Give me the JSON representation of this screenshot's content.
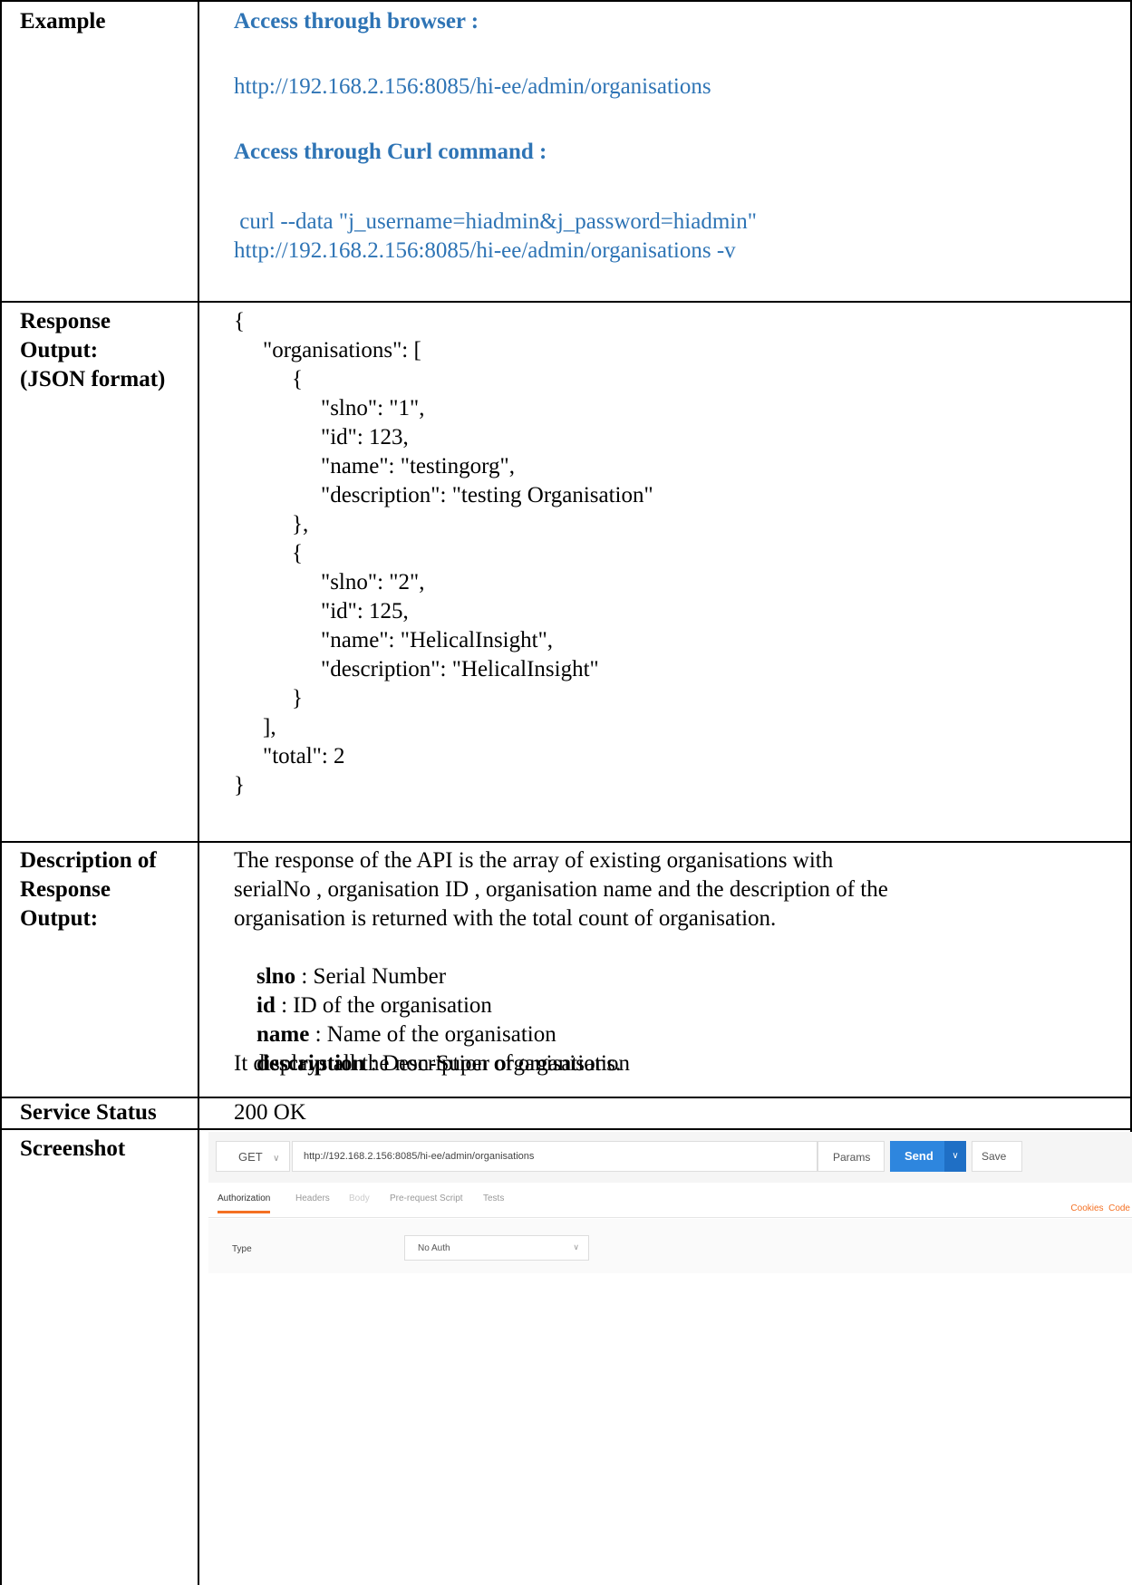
{
  "rows": {
    "example": {
      "label": "Example",
      "browser_heading": "Access through browser :",
      "browser_url": "http://192.168.2.156:8085/hi-ee/admin/organisations",
      "curl_heading": "Access through Curl command :",
      "curl_line1": " curl --data \"j_username=hiadmin&j_password=hiadmin\"",
      "curl_line2": "http://192.168.2.156:8085/hi-ee/admin/organisations -v"
    },
    "response": {
      "label_line1": "Response",
      "label_line2": "Output:",
      "label_line3": "(JSON format)",
      "json_lines": [
        "{",
        "\"organisations\": [",
        "{",
        "\"slno\": \"1\",",
        "\"id\": 123,",
        "\"name\": \"testingorg\",",
        "\"description\": \"testing Organisation\"",
        "},",
        "{",
        "\"slno\": \"2\",",
        "\"id\": 125,",
        "\"name\": \"HelicalInsight\",",
        "\"description\": \"HelicalInsight\"",
        "}",
        "],",
        "\"total\": 2",
        "}"
      ]
    },
    "description": {
      "label_line1": "Description of",
      "label_line2": "Response",
      "label_line3": "Output:",
      "para_line1": "The response of the API is the array of existing organisations with",
      "para_line2": "serialNo , organisation ID , organisation name and the description of the",
      "para_line3": "organisation is returned with the total count of organisation.",
      "fields": [
        {
          "key": "slno",
          "text": " : Serial Number"
        },
        {
          "key": "id",
          "text": " : ID of the organisation"
        },
        {
          "key": "name",
          "text": " : Name of the organisation"
        },
        {
          "key": "description",
          "text": " : Description of organisation"
        }
      ],
      "footer": "It displays all the non-Super organisations."
    },
    "status": {
      "label": "Service Status",
      "value": "200 OK"
    },
    "screenshot": {
      "label": "Screenshot",
      "method": "GET",
      "url": "http://192.168.2.156:8085/hi-ee/admin/organisations",
      "params": "Params",
      "send": "Send",
      "save": "Save",
      "tabs": [
        "Authorization",
        "Headers",
        "Body",
        "Pre-request Script",
        "Tests"
      ],
      "cookies_code": "Cookies  Code",
      "type_label": "Type",
      "type_value": "No Auth"
    }
  }
}
